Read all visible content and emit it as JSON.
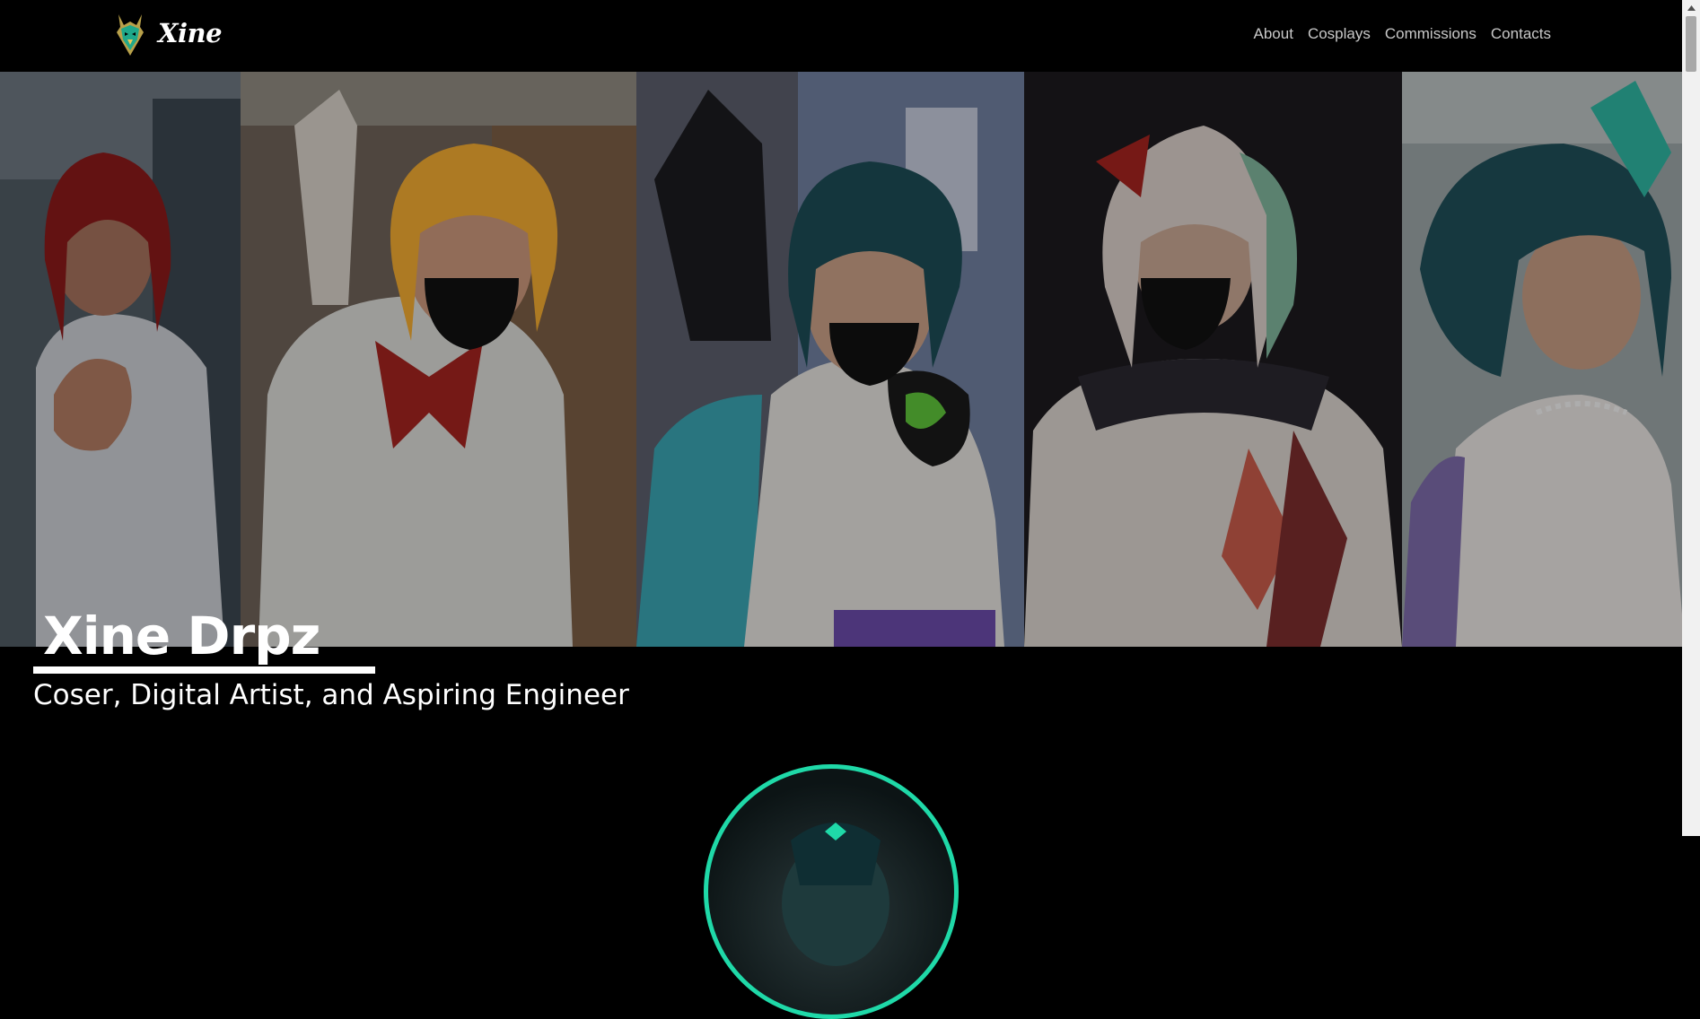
{
  "brand": {
    "name": "Xine"
  },
  "nav": {
    "items": [
      {
        "label": "About"
      },
      {
        "label": "Cosplays"
      },
      {
        "label": "Commissions"
      },
      {
        "label": "Contacts"
      }
    ]
  },
  "hero": {
    "title": "Xine Drpz",
    "subtitle": "Coser, Digital Artist, and Aspiring Engineer",
    "panels": [
      {
        "name": "cosplay-photo-red-hair"
      },
      {
        "name": "cosplay-photo-orange-hair"
      },
      {
        "name": "cosplay-photo-teal-hair-mask"
      },
      {
        "name": "cosplay-photo-white-red-hair"
      },
      {
        "name": "cosplay-photo-teal-hair-horns"
      }
    ]
  },
  "colors": {
    "background": "#000000",
    "accent": "#1fd9a8",
    "nav_text": "#c9c9c9"
  },
  "icons": {
    "logo": "dragon-mask-logo-icon",
    "scroll_up": "scroll-up-arrow-icon"
  }
}
